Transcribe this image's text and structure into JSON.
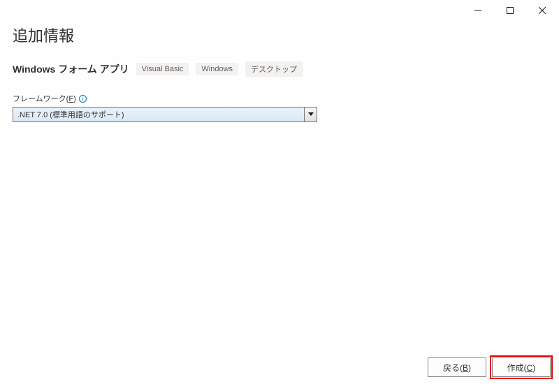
{
  "titlebar": {
    "minimize_name": "minimize-button",
    "maximize_name": "maximize-button",
    "close_name": "close-button"
  },
  "header": {
    "title": "追加情報",
    "project_name": "Windows フォーム アプリ",
    "tags": [
      "Visual Basic",
      "Windows",
      "デスクトップ"
    ]
  },
  "framework": {
    "label_prefix": "フレームワーク(",
    "label_key": "F",
    "label_suffix": ")",
    "selected": ".NET 7.0 (標準用語のサポート)"
  },
  "footer": {
    "back_prefix": "戻る(",
    "back_key": "B",
    "back_suffix": ")",
    "create_prefix": "作成(",
    "create_key": "C",
    "create_suffix": ")"
  }
}
